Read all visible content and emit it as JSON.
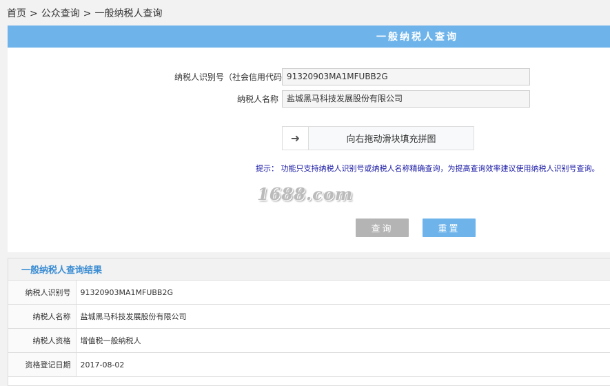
{
  "breadcrumb": {
    "home": "首页",
    "sep1": ">",
    "public_query": "公众查询",
    "sep2": ">",
    "current": "一般纳税人查询"
  },
  "panel": {
    "title": "一般纳税人查询"
  },
  "form": {
    "tax_id_label": "纳税人识别号（社会信用代码）",
    "tax_id_value": "91320903MA1MFUBB2G",
    "name_label": "纳税人名称",
    "name_value": "盐城黑马科技发展股份有限公司"
  },
  "slider": {
    "handle_icon": "arrow-right-icon",
    "handle_glyph": "➜",
    "text": "向右拖动滑块填充拼图"
  },
  "hint": "提示： 功能只支持纳税人识别号或纳税人名称精确查询，为提高查询效率建议使用纳税人识别号查询。",
  "watermark": "1688.com",
  "buttons": {
    "query": "查询",
    "reset": "重置"
  },
  "result": {
    "title": "一般纳税人查询结果",
    "rows": [
      {
        "label": "纳税人识别号",
        "value": "91320903MA1MFUBB2G"
      },
      {
        "label": "纳税人名称",
        "value": "盐城黑马科技发展股份有限公司"
      },
      {
        "label": "纳税人资格",
        "value": "增值税一般纳税人"
      },
      {
        "label": "资格登记日期",
        "value": "2017-08-02"
      }
    ]
  },
  "colors": {
    "header_blue": "#6eb4eb",
    "query_button_gray": "#b4b4b4",
    "hint_blue": "#1a1aa6",
    "result_title_blue": "#3c8dd4"
  }
}
